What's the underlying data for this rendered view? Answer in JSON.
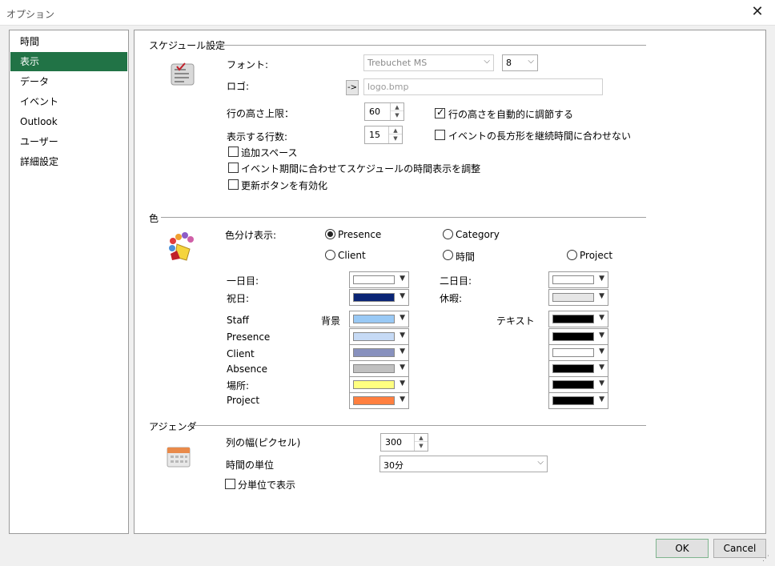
{
  "window": {
    "title": "オプション"
  },
  "sidebar": {
    "items": [
      {
        "label": "時間"
      },
      {
        "label": "表示"
      },
      {
        "label": "データ"
      },
      {
        "label": "イベント"
      },
      {
        "label": "Outlook"
      },
      {
        "label": "ユーザー"
      },
      {
        "label": "詳細設定"
      }
    ],
    "active_index": 1,
    "active_color": "#217346"
  },
  "schedule": {
    "title": "スケジュール設定",
    "font_label": "フォント:",
    "font_value": "Trebuchet MS",
    "font_size": "8",
    "logo_label": "ロゴ:",
    "logo_button": "->",
    "logo_placeholder": "logo.bmp",
    "row_height_label": "行の高さ上限：",
    "row_height_value": "60",
    "auto_row_height_label": "行の高さを自動的に調節する",
    "rows_label": "表示する行数:",
    "rows_value": "15",
    "no_fit_label": "イベントの長方形を継続時間に合わせない",
    "extra_space_label": "追加スペース",
    "adjust_label": "イベント期間に合わせてスケジュールの時間表示を調整",
    "refresh_label": "更新ボタンを有効化"
  },
  "colors": {
    "title": "色",
    "color_by_label": "色分け表示:",
    "options": {
      "presence": "Presence",
      "category": "Category",
      "client": "Client",
      "time": "時間",
      "project": "Project"
    },
    "selected": "Presence",
    "day1_label": "一日目:",
    "day2_label": "二日目:",
    "holiday_label": "祝日:",
    "vacation_label": "休暇:",
    "bg_header": "背景",
    "text_header": "テキスト",
    "day1_color": "#ffffff",
    "day2_color": "#ffffff",
    "holiday_color": "#0a2575",
    "vacation_color": "#e6e6e6",
    "rows": [
      {
        "label": "Staff",
        "bg": "#99c9f5",
        "text": "#000000"
      },
      {
        "label": "Presence",
        "bg": "#c6daf5",
        "text": "#000000"
      },
      {
        "label": "Client",
        "bg": "#8891be",
        "text": "#ffffff"
      },
      {
        "label": "Absence",
        "bg": "#c0c0c0",
        "text": "#000000"
      },
      {
        "label": "場所:",
        "bg": "#ffff80",
        "text": "#000000"
      },
      {
        "label": "Project",
        "bg": "#ff7f3f",
        "text": "#000000"
      }
    ]
  },
  "agenda": {
    "title": "アジェンダ",
    "column_width_label": "列の幅(ピクセル)",
    "column_width_value": "300",
    "time_unit_label": "時間の単位",
    "time_unit_value": "30分",
    "minute_display_label": "分単位で表示"
  },
  "footer": {
    "ok_label": "OK",
    "cancel_label": "Cancel"
  }
}
